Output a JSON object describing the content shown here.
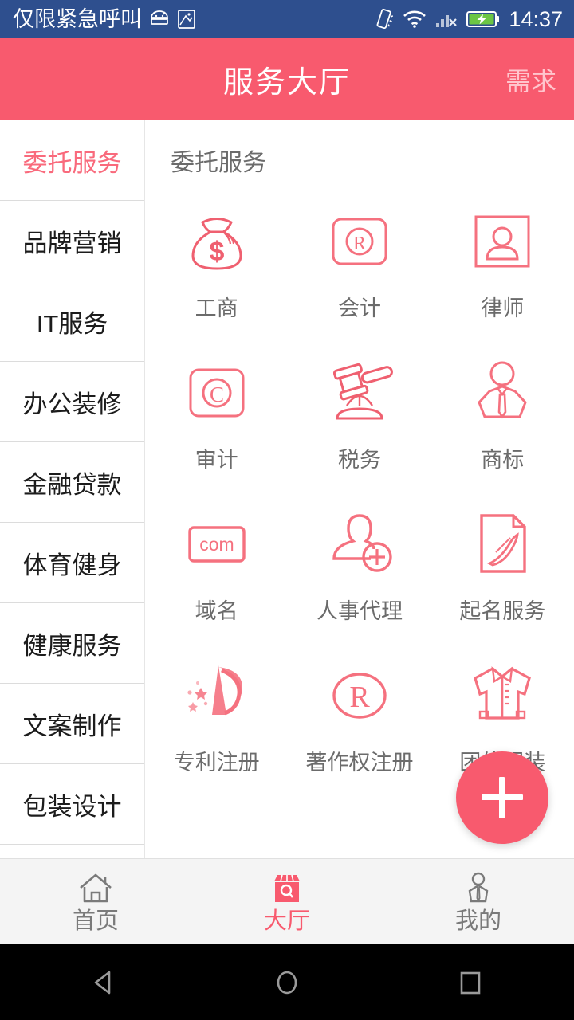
{
  "statusbar": {
    "carrier": "仅限紧急呼叫",
    "time": "14:37",
    "icons": [
      "vibrate-icon",
      "android-icon",
      "screenshot-icon",
      "wifi-icon",
      "signal-no-service-icon",
      "battery-charging-icon"
    ]
  },
  "header": {
    "title": "服务大厅",
    "action_label": "需求",
    "bg_color": "#f85a6e",
    "title_color": "#ffffff",
    "action_color": "#ffc5cd"
  },
  "sidebar": {
    "active_index": 0,
    "active_color": "#f96a7c",
    "items": [
      {
        "label": "委托服务"
      },
      {
        "label": "品牌营销"
      },
      {
        "label": "IT服务"
      },
      {
        "label": "办公装修"
      },
      {
        "label": "金融贷款"
      },
      {
        "label": "体育健身"
      },
      {
        "label": "健康服务"
      },
      {
        "label": "文案制作"
      },
      {
        "label": "包装设计"
      }
    ]
  },
  "content": {
    "section_title": "委托服务",
    "items": [
      {
        "label": "工商",
        "icon": "money-bag-icon"
      },
      {
        "label": "会计",
        "icon": "registered-rounded-square-icon"
      },
      {
        "label": "律师",
        "icon": "person-square-icon"
      },
      {
        "label": "审计",
        "icon": "copyright-rounded-square-icon"
      },
      {
        "label": "税务",
        "icon": "gavel-icon"
      },
      {
        "label": "商标",
        "icon": "businessman-tie-icon"
      },
      {
        "label": "域名",
        "icon": "com-box-icon"
      },
      {
        "label": "人事代理",
        "icon": "person-add-icon"
      },
      {
        "label": "起名服务",
        "icon": "document-pen-icon"
      },
      {
        "label": "专利注册",
        "icon": "comet-star-icon"
      },
      {
        "label": "著作权注册",
        "icon": "registered-circle-icon"
      },
      {
        "label": "团体服装",
        "icon": "jacket-icon"
      }
    ]
  },
  "fab": {
    "label": "+",
    "name": "add-button",
    "color": "#f85a6e"
  },
  "bottomnav": {
    "active_index": 1,
    "active_color": "#f85a6e",
    "items": [
      {
        "label": "首页",
        "icon": "home-icon"
      },
      {
        "label": "大厅",
        "icon": "shop-search-icon"
      },
      {
        "label": "我的",
        "icon": "user-profile-icon"
      }
    ]
  },
  "androidnav": {
    "back": "back-triangle-icon",
    "home": "home-circle-icon",
    "recents": "recents-square-icon"
  }
}
